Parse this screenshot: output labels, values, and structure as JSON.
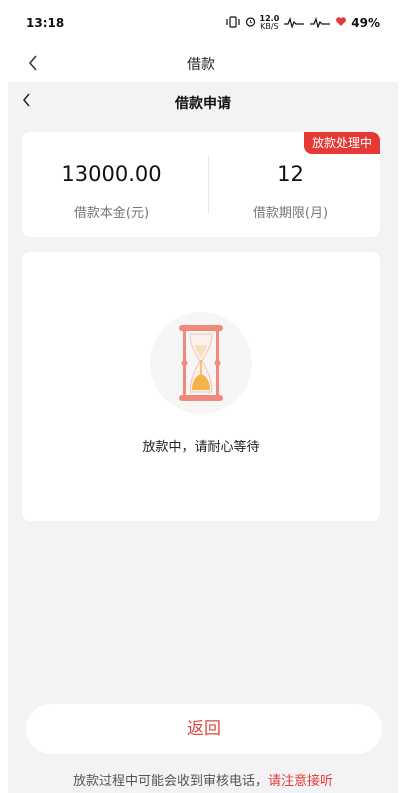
{
  "status_bar": {
    "time": "13:18",
    "net_speed_value": "12.0",
    "net_speed_unit": "KB/S",
    "battery": "49%"
  },
  "outer_nav": {
    "title": "借款"
  },
  "inner_nav": {
    "title": "借款申请"
  },
  "summary": {
    "badge": "放款处理中",
    "principal_value": "13000.00",
    "principal_label": "借款本金(元)",
    "term_value": "12",
    "term_label": "借款期限(月)"
  },
  "wait": {
    "message": "放款中，请耐心等待"
  },
  "return_button": {
    "label": "返回"
  },
  "notice": {
    "text": "放款过程中可能会收到审核电话，",
    "highlight": "请注意接听"
  },
  "colors": {
    "accent": "#e53935",
    "button_text": "#e0473e",
    "background": "#f3f3f5",
    "hourglass_frame": "#f0897a",
    "sand": "#f7b24a"
  }
}
